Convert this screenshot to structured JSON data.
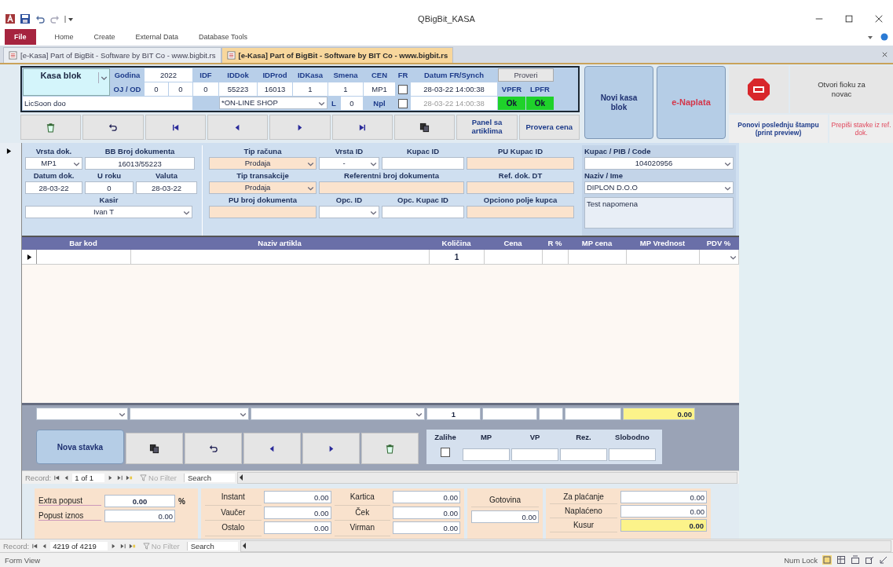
{
  "window": {
    "title": "QBigBit_KASA"
  },
  "ribbon": {
    "file": "File",
    "tabs": [
      "Home",
      "Create",
      "External Data",
      "Database Tools"
    ]
  },
  "document_tabs": [
    {
      "label": "[e-Kasa] Part of BigBit  -  Software by BIT Co  -  www.bigbit.rs",
      "selected": false
    },
    {
      "label": "[e-Kasa] Part of BigBit  -  Software by BIT Co  -  www.bigbit.rs",
      "selected": true
    }
  ],
  "header_panel": {
    "kasa_blok": "Kasa blok",
    "company": "LicSoon doo",
    "godina_label": "Godina",
    "godina": "2022",
    "oj_od_label": "OJ / OD",
    "oj": "0",
    "od": "0",
    "columns": [
      {
        "label": "IDF",
        "value": "0"
      },
      {
        "label": "IDDok",
        "value": "55223"
      },
      {
        "label": "IDProd",
        "value": "16013"
      },
      {
        "label": "IDKasa",
        "value": "1"
      },
      {
        "label": "Smena",
        "value": "1"
      },
      {
        "label": "CEN",
        "value": "MP1"
      }
    ],
    "fr_label": "FR",
    "fr_checked": false,
    "npl_checked": false,
    "datum_label": "Datum FR/Synch",
    "datum": "28-03-22 14:00:38",
    "synch": "28-03-22 14:00:38",
    "proveri": "Proveri",
    "vpfr": "VPFR",
    "lpfr": "LPFR",
    "vpfr_status": "Ok",
    "lpfr_status": "Ok",
    "shop": "*ON-LINE SHOP",
    "l_label": "L",
    "l_value": "0",
    "npl_label": "Npl"
  },
  "toolbar": [
    {
      "kind": "delete"
    },
    {
      "kind": "undo"
    },
    {
      "kind": "first"
    },
    {
      "kind": "prev"
    },
    {
      "kind": "next"
    },
    {
      "kind": "last"
    },
    {
      "kind": "copy"
    },
    {
      "kind": "text",
      "label": "Panel sa artiklima"
    },
    {
      "kind": "text",
      "label": "Provera cena"
    }
  ],
  "side_buttons": {
    "new_receipt": "Novi kasa blok",
    "e_payment": "e-Naplata",
    "open_drawer": "Otvori fioku za novac",
    "reprint": "Ponovi poslednju štampu (print preview)",
    "copy_items": "Prepiši stavke iz ref. dok."
  },
  "document_fields": {
    "left": [
      [
        {
          "label": "Vrsta dok.",
          "value": "MP1",
          "kind": "combo",
          "highlighted": false
        },
        {
          "label": "BB Broj dokumenta",
          "value": "16013/55223",
          "kind": "text",
          "highlighted": false
        }
      ],
      [
        {
          "label": "Datum dok.",
          "value": "28-03-22",
          "kind": "text",
          "highlighted": false
        },
        {
          "label": "U roku",
          "value": "0",
          "kind": "text",
          "highlighted": false
        },
        {
          "label": "Valuta",
          "value": "28-03-22",
          "kind": "text",
          "highlighted": false
        }
      ],
      [
        {
          "label": "Kasir",
          "value": "Ivan T",
          "kind": "combo",
          "highlighted": false
        }
      ]
    ],
    "middle": [
      [
        {
          "label": "Tip računa",
          "value": "Prodaja",
          "kind": "combo",
          "highlighted": true
        },
        {
          "label": "Vrsta ID",
          "value": "-",
          "kind": "combo",
          "highlighted": false
        },
        {
          "label": "Kupac ID",
          "kind": "text",
          "highlighted": false
        },
        {
          "label": "PU Kupac ID",
          "kind": "text",
          "highlighted": true
        }
      ],
      [
        {
          "label": "Tip transakcije",
          "value": "Prodaja",
          "kind": "combo",
          "highlighted": true
        },
        {
          "label": "Referentni broj dokumenta",
          "kind": "text",
          "highlighted": true
        },
        {
          "label": "Ref. dok. DT",
          "kind": "text",
          "highlighted": true
        }
      ],
      [
        {
          "label": "PU broj dokumenta",
          "kind": "text",
          "highlighted": true
        },
        {
          "label": "Opc. ID",
          "kind": "combo",
          "highlighted": false
        },
        {
          "label": "Opc. Kupac ID",
          "kind": "text",
          "highlighted": false
        },
        {
          "label": "Opciono polje kupca",
          "kind": "text",
          "highlighted": true
        }
      ]
    ]
  },
  "customer": {
    "code_label": "Kupac / PIB / Code",
    "code": "104020956",
    "name_label": "Naziv / Ime",
    "name": "DIPLON D.O.O",
    "note": "Test napomena"
  },
  "items_table": {
    "columns": [
      "Bar kod",
      "Naziv artikla",
      "Količina",
      "Cena",
      "R %",
      "MP cena",
      "MP Vrednost",
      "PDV %"
    ],
    "rows": [
      {
        "current": true,
        "quantity": "1"
      }
    ]
  },
  "entry_row": {
    "quantity": "1",
    "mp_value": "0.00"
  },
  "item_buttons": [
    {
      "kind": "text",
      "label": "Nova stavka"
    },
    {
      "kind": "copy"
    },
    {
      "kind": "undo"
    },
    {
      "kind": "prev"
    },
    {
      "kind": "next"
    },
    {
      "kind": "delete"
    }
  ],
  "stock": {
    "label": "Zalihe",
    "checked": false,
    "columns": [
      "MP",
      "VP",
      "Rez.",
      "Slobodno"
    ]
  },
  "subform_navigation": {
    "label": "Record:",
    "position": "1 of 1",
    "filter": "No Filter",
    "search": "Search"
  },
  "discount": [
    {
      "label": "Extra popust",
      "value": "0.00",
      "unit": "%"
    },
    {
      "label": "Popust iznos",
      "value": "0.00"
    }
  ],
  "payments": [
    {
      "label": "Instant",
      "value": "0.00"
    },
    {
      "label": "Kartica",
      "value": "0.00"
    },
    {
      "label": "Vaučer",
      "value": "0.00"
    },
    {
      "label": "Ček",
      "value": "0.00"
    },
    {
      "label": "Ostalo",
      "value": "0.00"
    },
    {
      "label": "Virman",
      "value": "0.00"
    }
  ],
  "cash": {
    "label": "Gotovina",
    "value": "0.00"
  },
  "summary": [
    {
      "label": "Za plaćanje",
      "value": "0.00",
      "highlighted": false
    },
    {
      "label": "Naplaćeno",
      "value": "0.00",
      "highlighted": false
    },
    {
      "label": "Kusur",
      "value": "0.00",
      "highlighted": true
    }
  ],
  "form_navigation": {
    "label": "Record:",
    "position": "4219 of 4219",
    "filter": "No Filter",
    "search": "Search"
  },
  "status_bar": {
    "left": "Form View",
    "right": "Num Lock"
  }
}
